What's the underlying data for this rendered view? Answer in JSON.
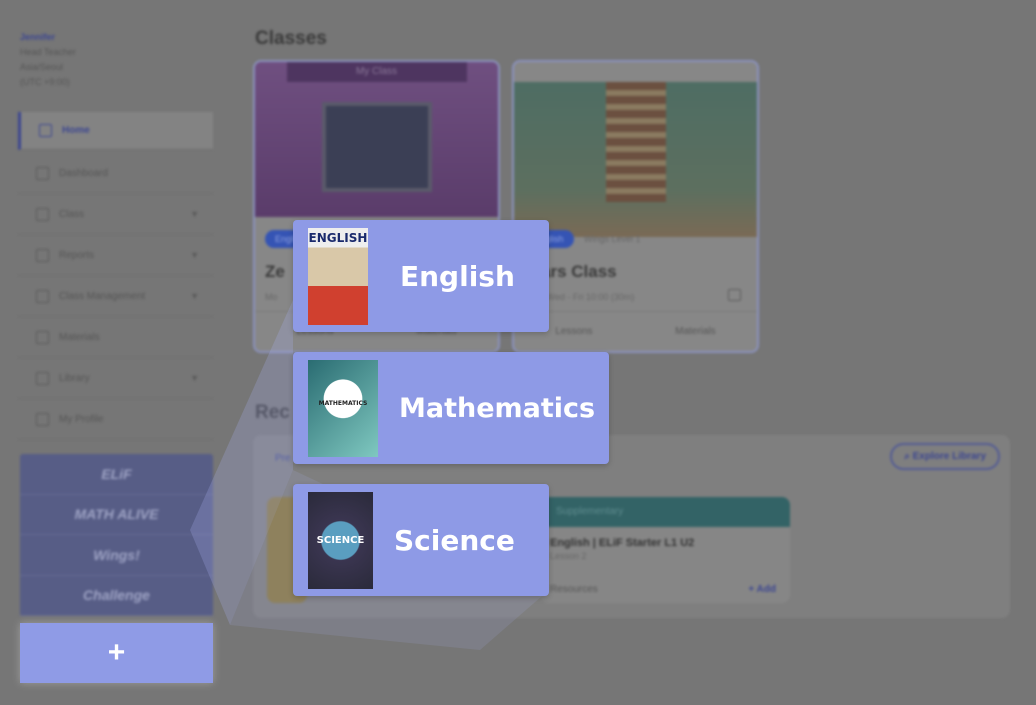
{
  "user": {
    "name": "Jennifer",
    "role": "Head Teacher",
    "location": "Asia/Seoul",
    "timezone": "(UTC +9:00)"
  },
  "nav": [
    {
      "label": "Home",
      "icon": "home-icon",
      "active": true
    },
    {
      "label": "Dashboard",
      "icon": "dashboard-icon"
    },
    {
      "label": "Class",
      "icon": "monitor-icon",
      "expandable": true
    },
    {
      "label": "Reports",
      "icon": "chart-icon",
      "expandable": true
    },
    {
      "label": "Class Management",
      "icon": "graduation-cap-icon",
      "expandable": true
    },
    {
      "label": "Materials",
      "icon": "file-icon"
    },
    {
      "label": "Library",
      "icon": "book-icon",
      "expandable": true
    },
    {
      "label": "My Profile",
      "icon": "profile-icon"
    }
  ],
  "programs": [
    "ELiF",
    "MATH ALIVE",
    "Wings!",
    "Challenge"
  ],
  "plus_label": "+",
  "classes": {
    "title": "Classes",
    "cards": [
      {
        "banner": "My Class",
        "badge": "English",
        "title": "Ze",
        "schedule": "Mo",
        "lessons": "Lessons",
        "materials": "Materials"
      },
      {
        "badge": "English",
        "level": "Wings Level 1",
        "title": "Stars Class",
        "schedule": "Mon, Wed - Fri 10:00 (30m)",
        "lessons": "Lessons",
        "materials": "Materials"
      }
    ]
  },
  "recent": {
    "title": "Rec",
    "tab": "Pre",
    "explore": "Explore Library",
    "card": {
      "header": "Supplementary",
      "title": "English | ELiF Starter L1 U2",
      "sub": "Lesson 2",
      "resources": "Resources",
      "add": "+ Add"
    }
  },
  "subjects": [
    {
      "label": "English",
      "cover_text": "ENGLISH"
    },
    {
      "label": "Mathematics",
      "cover_text": "MATHEMATICS"
    },
    {
      "label": "Science",
      "cover_text": "SCIENCE"
    }
  ],
  "colors": {
    "popup": "#8e9ae6",
    "accent": "#3c4690",
    "overlay": "#767676"
  }
}
